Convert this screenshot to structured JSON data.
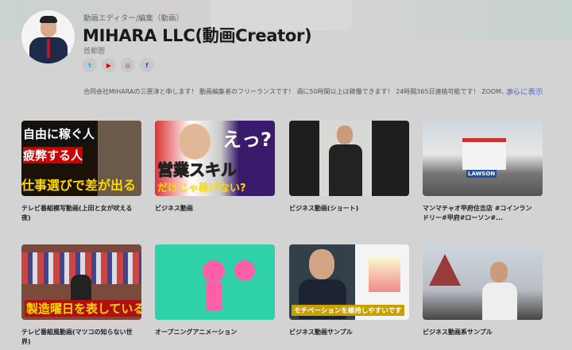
{
  "profile": {
    "category": "動画エディター/編集（動画）",
    "name": "MIHARA LLC(動画Creator)",
    "region": "首都圏",
    "bio": "合同会社MIHARAの三原淳と申します！ 動画編集者のフリーランスです！ 週に50時間以上は稼働できます！ 24時間365日連絡可能です！ ZOOM、sl…",
    "more_label": "さらに表示"
  },
  "social": [
    {
      "icon": "twitter-icon",
      "glyph": "t",
      "color": "#1da1f2"
    },
    {
      "icon": "youtube-icon",
      "glyph": "▶",
      "color": "#e00000"
    },
    {
      "icon": "instagram-icon",
      "glyph": "◎",
      "color": "#c13584"
    },
    {
      "icon": "facebook-icon",
      "glyph": "f",
      "color": "#3b5998"
    }
  ],
  "works": [
    {
      "title": "テレビ番組模写動画(上田と女が吠える夜)",
      "thumb_text": [
        "自由に稼ぐ人",
        "疲弊する人",
        "仕事選びで差が出る"
      ]
    },
    {
      "title": "ビジネス動画",
      "thumb_text": [
        "えっ?",
        "営業スキル",
        "だけじゃ稼げない?"
      ]
    },
    {
      "title": "ビジネス動画(ショート)",
      "thumb_text": []
    },
    {
      "title": "マンマチャオ甲府住吉店 #コインランドリー#甲府#ローソン#...",
      "thumb_text": [
        "LAWSON"
      ]
    },
    {
      "title": "テレビ番組風動画(マツコの知らない世界)",
      "thumb_text": [
        "製造曜日を表している"
      ]
    },
    {
      "title": "オープニングアニメーション",
      "thumb_text": []
    },
    {
      "title": "ビジネス動画サンプル",
      "thumb_text": [
        "モチベーションを維持しやすいです"
      ]
    },
    {
      "title": "ビジネス動画系サンプル",
      "thumb_text": []
    }
  ]
}
